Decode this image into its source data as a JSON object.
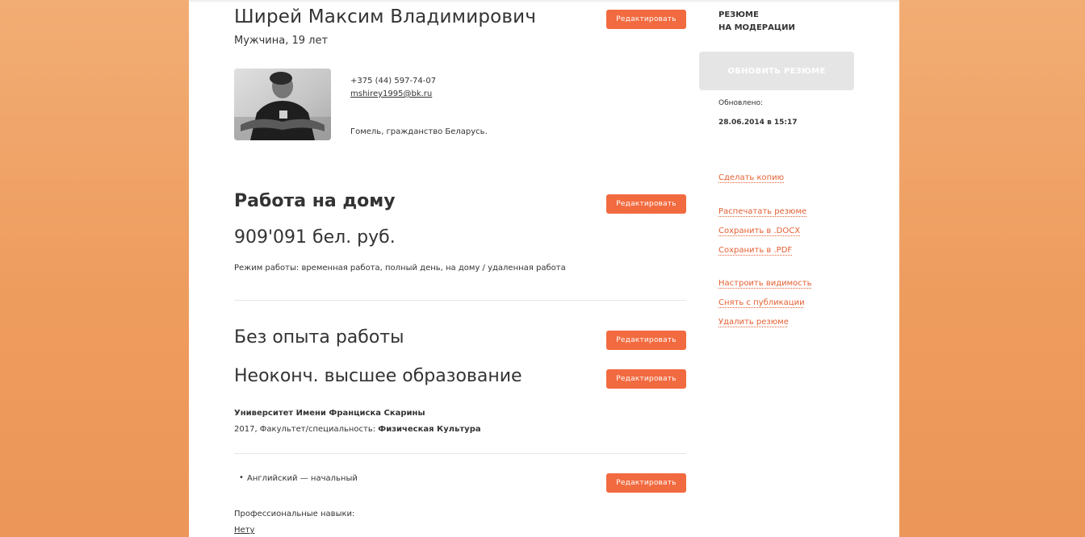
{
  "profile": {
    "name": "Ширей Максим Владимирович",
    "gender_age": "Мужчина, 19 лет",
    "phone": "+375 (44) 597-74-07",
    "email": "mshirey1995@bk.ru",
    "city": "Гомель, гражданство Беларусь."
  },
  "edit_label": "Редактировать",
  "position": {
    "title": "Работа на дому",
    "salary": "909'091 бел. руб.",
    "work_mode": "Режим работы: временная работа, полный день, на дому / удаленная работа"
  },
  "experience": {
    "title": "Без опыта работы"
  },
  "education": {
    "title": "Неоконч. высшее образование",
    "university": "Университет Имени Франциска Скарины",
    "details_prefix": "2017, Факультет/специальность: ",
    "specialty": "Физическая Культура"
  },
  "languages": {
    "bullet": "•",
    "item": "Английский — начальный"
  },
  "skills": {
    "label": "Профессиональные навыки:",
    "value": "Нету"
  },
  "sidebar": {
    "status_line1": "РЕЗЮМЕ",
    "status_line2": "НА МОДЕРАЦИИ",
    "update_button": "ОБНОВИТЬ РЕЗЮМЕ",
    "updated_label": "Обновлено:",
    "updated_value": "28.06.2014 в 15:17",
    "links": {
      "copy": "Сделать копию",
      "print": "Распечатать резюме",
      "save_docx": "Сохранить в .DOCX",
      "save_pdf": "Сохранить в .PDF",
      "visibility": "Настроить видимость",
      "unpublish": "Снять с публикации",
      "delete": "Удалить резюме"
    }
  },
  "colors": {
    "accent": "#f26a3f",
    "link": "#e35f33",
    "background": "#ee9c5e"
  }
}
